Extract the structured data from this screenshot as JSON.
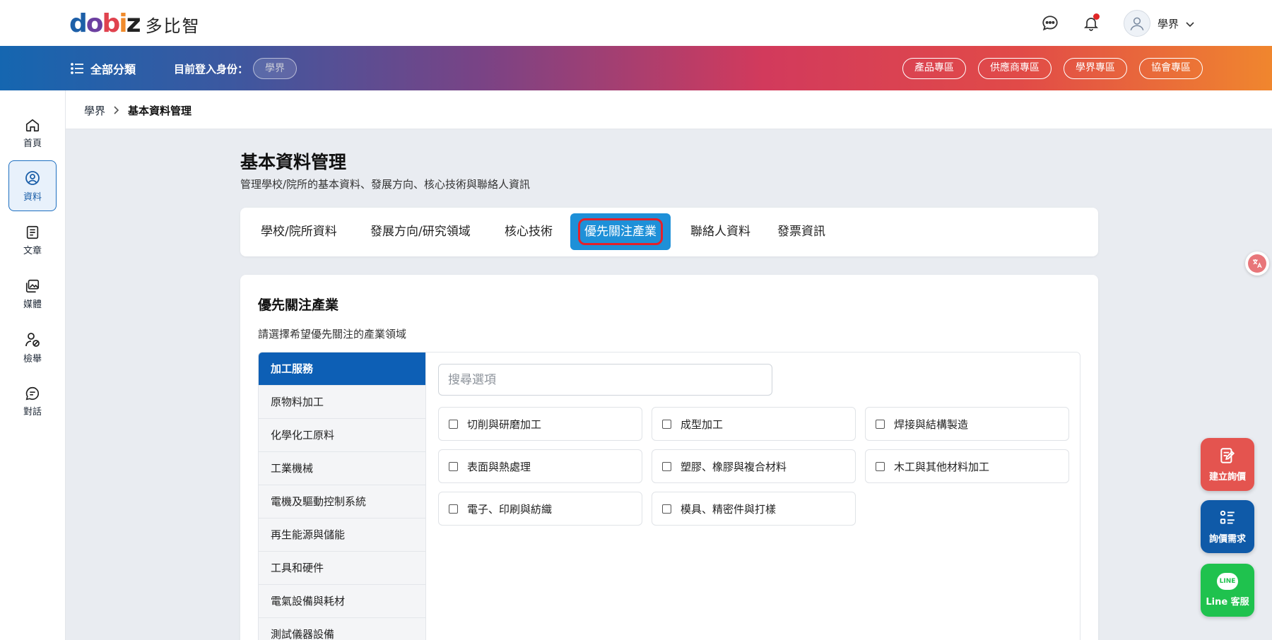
{
  "header": {
    "logo_text": "多比智",
    "user_name": "學界"
  },
  "navbar": {
    "all_categories": "全部分類",
    "role_label": "目前登入身份：",
    "role_value": "學界",
    "zones": [
      "產品專區",
      "供應商專區",
      "學界專區",
      "協會專區"
    ]
  },
  "sidebar": {
    "items": [
      {
        "label": "首頁",
        "icon": "home-icon"
      },
      {
        "label": "資料",
        "icon": "user-circle-icon"
      },
      {
        "label": "文章",
        "icon": "document-icon"
      },
      {
        "label": "媒體",
        "icon": "media-icon"
      },
      {
        "label": "檢舉",
        "icon": "report-user-icon"
      },
      {
        "label": "對話",
        "icon": "chat-icon"
      }
    ],
    "active_index": 1
  },
  "breadcrumb": {
    "root": "學界",
    "current": "基本資料管理"
  },
  "page": {
    "title": "基本資料管理",
    "subtitle": "管理學校/院所的基本資料、發展方向、核心技術與聯絡人資訊"
  },
  "tabs": [
    {
      "label": "學校/院所資料"
    },
    {
      "label": "發展方向/研究領域"
    },
    {
      "label": "核心技術"
    },
    {
      "label": "優先關注產業"
    },
    {
      "label": "聯絡人資料"
    },
    {
      "label": "發票資訊"
    }
  ],
  "section": {
    "title": "優先關注產業",
    "description": "請選擇希望優先關注的產業領域"
  },
  "categories": [
    "加工服務",
    "原物料加工",
    "化學化工原料",
    "工業機械",
    "電機及驅動控制系統",
    "再生能源與儲能",
    "工具和硬件",
    "電氣設備與耗材",
    "測試儀器設備"
  ],
  "search": {
    "placeholder": "搜尋選項",
    "value": ""
  },
  "options": [
    {
      "label": "切削與研磨加工",
      "checked": false
    },
    {
      "label": "成型加工",
      "checked": false
    },
    {
      "label": "焊接與結構製造",
      "checked": false
    },
    {
      "label": "表面與熱處理",
      "checked": false
    },
    {
      "label": "塑膠、橡膠與複合材料",
      "checked": false
    },
    {
      "label": "木工與其他材料加工",
      "checked": false
    },
    {
      "label": "電子、印刷與紡織",
      "checked": false
    },
    {
      "label": "模具、精密件與打樣",
      "checked": false
    }
  ],
  "fabs": {
    "create_inquiry": "建立詢價",
    "inquiry_demand": "詢價需求",
    "line_service": "Line 客服",
    "line_badge": "LINE"
  },
  "colors": {
    "brand_blue": "#0d5fb5",
    "tab_active": "#1e90d8",
    "highlight_red": "#e5202a",
    "fab_red": "#e4544f",
    "fab_blue": "#0f5aa8",
    "fab_green": "#1fc24e"
  }
}
